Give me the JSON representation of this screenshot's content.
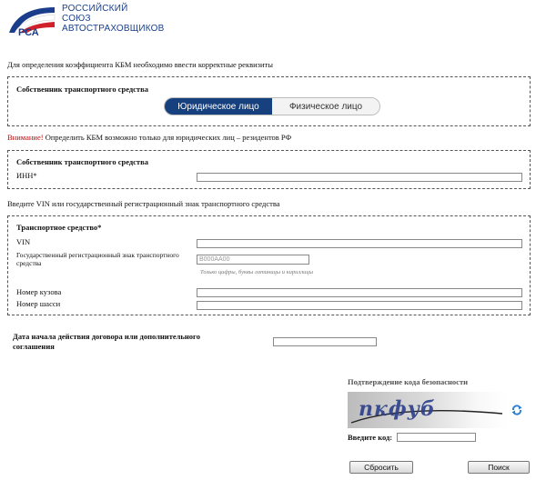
{
  "logo": {
    "acronym": "РСА",
    "line1": "РОССИЙСКИЙ",
    "line2": "СОЮЗ",
    "line3": "АВТОСТРАХОВЩИКОВ"
  },
  "intro_text": "Для определения коэффициента КБМ необходимо ввести корректные реквизиты",
  "owner_type": {
    "section_title": "Собственник транспортного средства",
    "option_legal": "Юридическое лицо",
    "option_individual": "Физическое лицо",
    "selected": "Юридическое лицо"
  },
  "notice": {
    "label": "Внимание!",
    "text": " Определить КБМ возможно только для юридических лиц – резидентов РФ"
  },
  "owner": {
    "section_title": "Собственник транспортного средства",
    "inn_label": "ИНН*",
    "inn_value": ""
  },
  "vehicle_intro": "Введите VIN или государственный регистрационный знак транспортного средства",
  "vehicle": {
    "section_title": "Транспортное средство*",
    "vin_label": "VIN",
    "vin_value": "",
    "plate_label": "Государственный регистрационный знак транспортного средства",
    "plate_placeholder": "В000АА00",
    "plate_hint": "Только цифры, буквы латиницы и кириллицы",
    "body_label": "Номер кузова",
    "body_value": "",
    "chassis_label": "Номер шасси",
    "chassis_value": ""
  },
  "contract": {
    "date_label": "Дата начала действия договора или дополнительного соглашения",
    "date_value": ""
  },
  "captcha": {
    "title": "Подтверждение кода безопасности",
    "image_text": "пкфуб",
    "code_label": "Введите код:",
    "code_value": ""
  },
  "buttons": {
    "reset": "Сбросить",
    "search": "Поиск"
  },
  "colors": {
    "brand_blue": "#17407f",
    "logo_red": "#d0202a",
    "notice_red": "#c00000"
  }
}
